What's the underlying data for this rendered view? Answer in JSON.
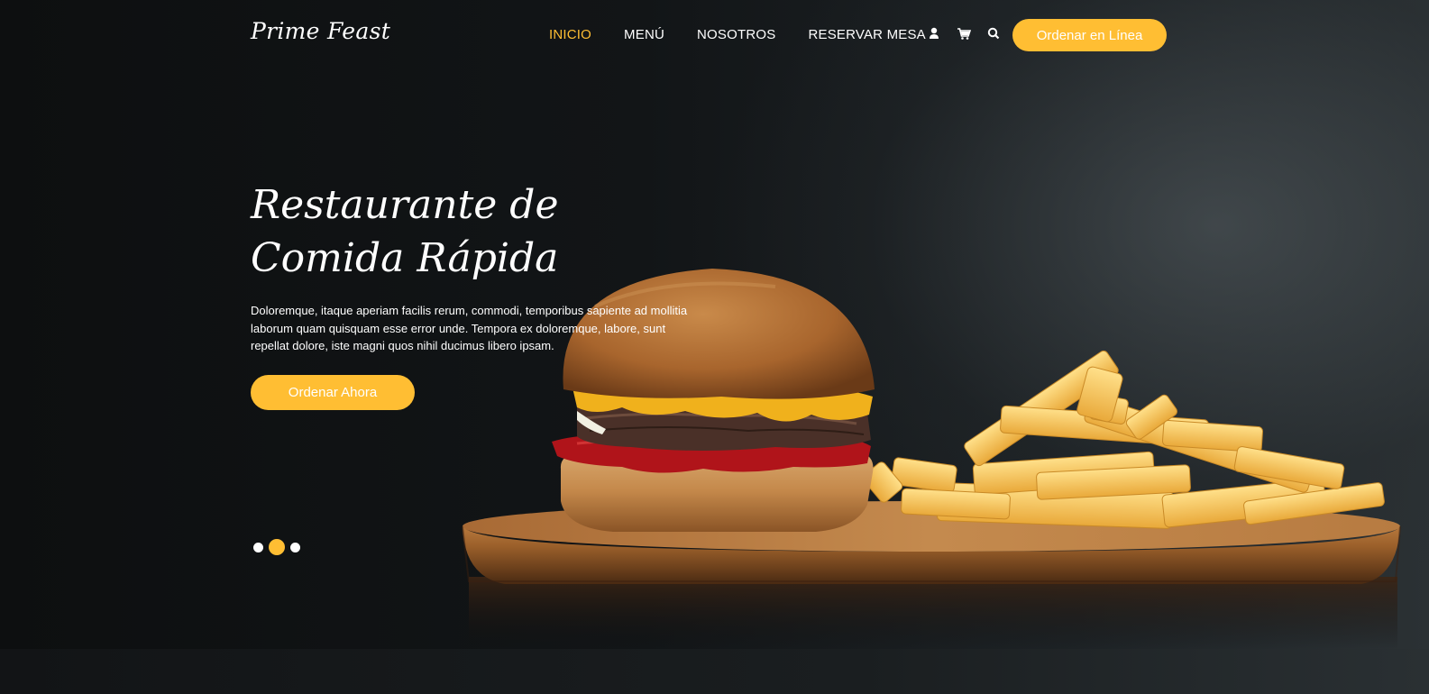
{
  "brand": {
    "name": "Prime Feast"
  },
  "nav": {
    "items": [
      {
        "label": "INICIO",
        "active": true
      },
      {
        "label": "MENÚ",
        "active": false
      },
      {
        "label": "NOSOTROS",
        "active": false
      },
      {
        "label": "RESERVAR MESA",
        "active": false
      }
    ],
    "icons": [
      "user-icon",
      "cart-icon",
      "search-icon"
    ],
    "order_online_label": "Ordenar en Línea"
  },
  "hero": {
    "title": "Restaurante de Comida Rápida",
    "text": "Doloremque, itaque aperiam facilis rerum, commodi, temporibus sapiente ad mollitia laborum quam quisquam esse error unde. Tempora ex doloremque, labore, sunt repellat dolore, iste magni quos nihil ducimus libero ipsam.",
    "button_label": "Ordenar Ahora"
  },
  "carousel": {
    "slides": 3,
    "active_index": 1
  },
  "image": {
    "subject": "burger-and-fries-on-wooden-board"
  },
  "colors": {
    "accent": "#ffbe33",
    "background": "#111416",
    "text": "#ffffff"
  }
}
